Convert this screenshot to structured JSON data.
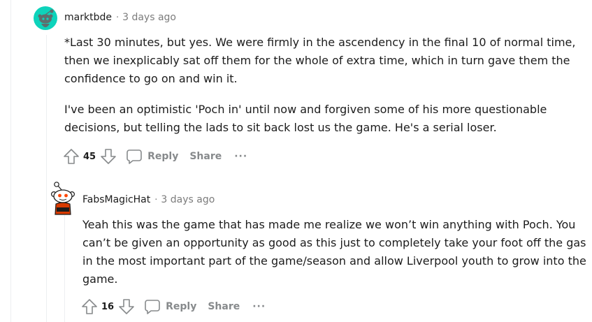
{
  "comments": [
    {
      "author": "marktbde",
      "separator": "·",
      "time": "3 days ago",
      "paragraphs": [
        "*Last 30 minutes, but yes. We were firmly in the ascendency in the final 10 of normal time, then we inexplicably sat off them for the whole of extra time, which in turn gave them the confidence to go on and win it.",
        "I've been an optimistic 'Poch in' until now and forgiven some of his more questionable decisions, but telling the lads to sit back lost us the game. He's a serial loser."
      ],
      "score": "45",
      "reply_label": "Reply",
      "share_label": "Share",
      "more_label": "···",
      "avatar_icon": "default-snoo-avatar-icon",
      "avatar_color": "#0dd3bb"
    },
    {
      "author": "FabsMagicHat",
      "separator": "·",
      "time": "3 days ago",
      "paragraphs": [
        "Yeah this was the game that has made me realize we won’t win anything with Poch. You can’t be given an opportunity as good as this just to completely take your foot off the gas in the most important part of the game/season and allow Liverpool youth to grow into the game."
      ],
      "score": "16",
      "reply_label": "Reply",
      "share_label": "Share",
      "more_label": "···",
      "avatar_icon": "snoo-character-avatar-icon",
      "avatar_color": "#d93a00"
    }
  ]
}
